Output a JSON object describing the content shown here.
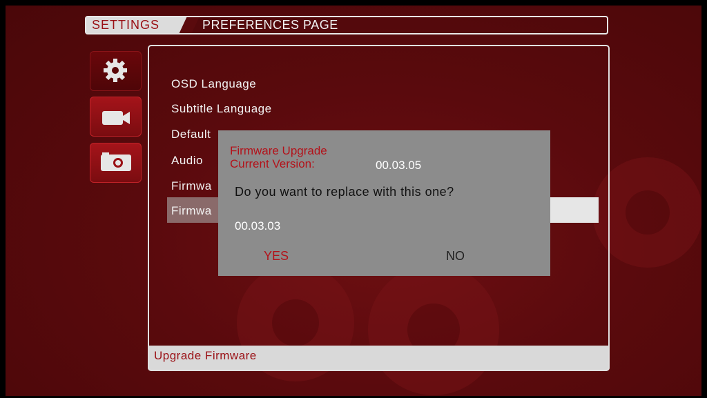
{
  "breadcrumb": {
    "active": "SETTINGS",
    "page": "PREFERENCES PAGE"
  },
  "sidebar": {
    "icons": [
      {
        "name": "gear-icon",
        "active": true
      },
      {
        "name": "video-camera-icon",
        "active": false
      },
      {
        "name": "photo-camera-icon",
        "active": false
      }
    ]
  },
  "menu": {
    "items": [
      "OSD Language",
      "Subtitle Language",
      "Default",
      "Audio",
      "Firmwa",
      "Firmwa"
    ]
  },
  "status": {
    "text": "Upgrade Firmware"
  },
  "dialog": {
    "title": "Firmware Upgrade",
    "current_version_label": "Current Version:",
    "current_version_value": "00.03.05",
    "question": "Do you want to replace with this one?",
    "new_version": "00.03.03",
    "yes_label": "YES",
    "no_label": "NO"
  },
  "colors": {
    "accent": "#b3121a",
    "background": "#5a0a0d",
    "dialog": "#8c8c8c"
  }
}
